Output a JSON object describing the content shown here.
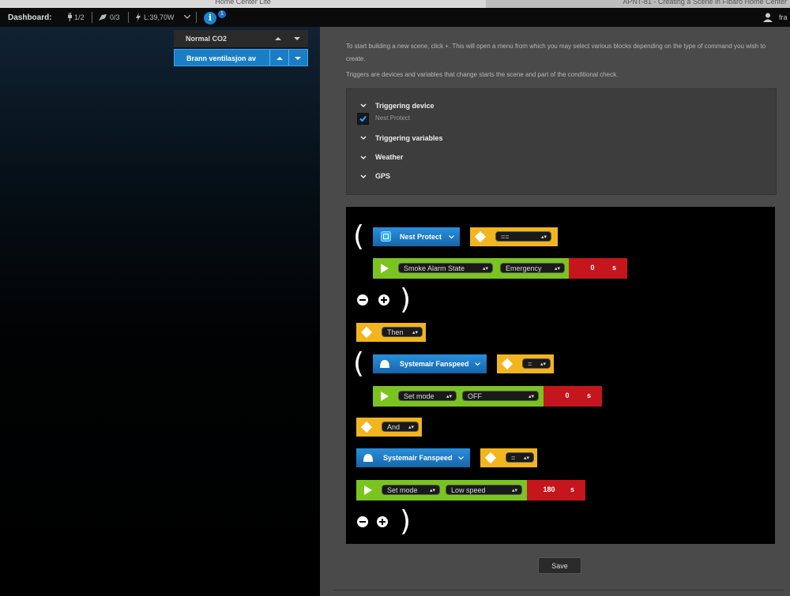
{
  "window": {
    "left_title": "Home Center Lite",
    "right_title": "APNT-81 - Creating a Scene in Fibaro Home Center"
  },
  "statusbar": {
    "label": "Dashboard:",
    "devices": "1/2",
    "scenes": "0/3",
    "power": "L:39,70W",
    "info_icon_text": "i",
    "info_badge": "1",
    "user": "fra"
  },
  "scene_list": [
    {
      "name": "Normal CO2",
      "active": false
    },
    {
      "name": "Brann ventilasjon av",
      "active": true
    }
  ],
  "intro": {
    "line1": "To start building a new scene, click +. This will open a menu from which you may select various blocks depending on the type of command you wish to create.",
    "line2": "Triggers are devices and variables that change starts the scene and part of the conditional check."
  },
  "triggers": {
    "device_heading": "Triggering device",
    "device_item": "Nest Protect",
    "device_item_checked": true,
    "variables_heading": "Triggering variables",
    "weather_heading": "Weather",
    "gps_heading": "GPS"
  },
  "editor": {
    "open_paren": "(",
    "close_paren": ")",
    "block1": {
      "device": "Nest Protect",
      "operator": "==",
      "property": "Smoke Alarm State",
      "value": "Emergency",
      "delay": "0",
      "unit": "s"
    },
    "then_label": "Then",
    "block2": {
      "device": "Systemair Fanspeed",
      "operator": "=",
      "property": "Set mode",
      "value": "OFF",
      "delay": "0",
      "unit": "s"
    },
    "and_label": "And",
    "block3": {
      "device": "Systemair Fanspeed",
      "operator": "=",
      "property": "Set mode",
      "value": "Low speed",
      "delay": "180",
      "unit": "s"
    }
  },
  "save_label": "Save",
  "colors": {
    "blue_block": "#1a7ec6",
    "yellow_block": "#f2b51e",
    "green_block": "#7ac420",
    "red_block": "#c4161c"
  }
}
